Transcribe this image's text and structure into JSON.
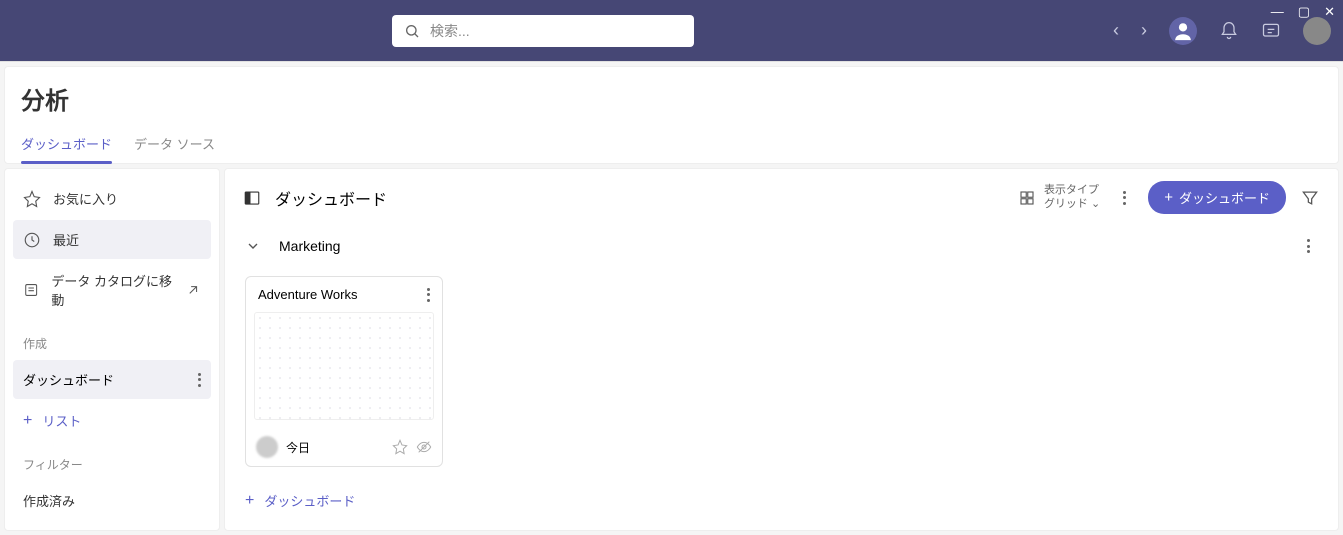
{
  "search": {
    "placeholder": "検索..."
  },
  "page": {
    "title": "分析"
  },
  "tabs": {
    "dashboards": "ダッシュボード",
    "datasources": "データ ソース"
  },
  "sidebar": {
    "favorites": "お気に入り",
    "recent": "最近",
    "goto_catalog": "データ カタログに移動",
    "create_label": "作成",
    "dashboard": "ダッシュボード",
    "list": "リスト",
    "filter_label": "フィルター",
    "created": "作成済み"
  },
  "main": {
    "title": "ダッシュボード",
    "view_type_label": "表示タイプ",
    "view_type_value": "グリッド",
    "new_dashboard": "ダッシュボード",
    "group": "Marketing",
    "card_title": "Adventure Works",
    "card_date": "今日",
    "add_dashboard": "ダッシュボード"
  }
}
